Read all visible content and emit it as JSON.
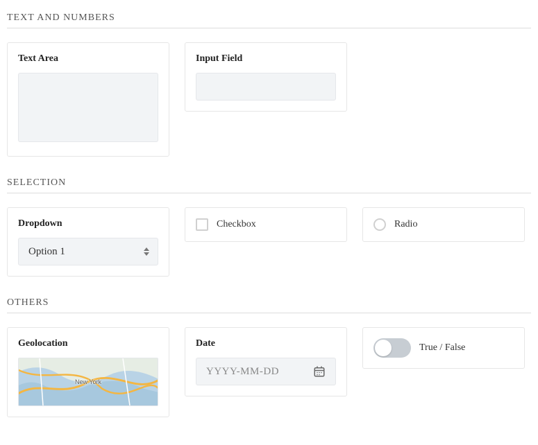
{
  "sections": {
    "text_numbers": {
      "title": "TEXT AND NUMBERS",
      "text_area": {
        "label": "Text Area",
        "value": ""
      },
      "input_field": {
        "label": "Input Field",
        "value": ""
      }
    },
    "selection": {
      "title": "SELECTION",
      "dropdown": {
        "label": "Dropdown",
        "selected": "Option 1"
      },
      "checkbox": {
        "label": "Checkbox",
        "checked": false
      },
      "radio": {
        "label": "Radio",
        "checked": false
      }
    },
    "others": {
      "title": "OTHERS",
      "geolocation": {
        "label": "Geolocation",
        "map_center_label": "New York"
      },
      "date": {
        "label": "Date",
        "placeholder": "YYYY-MM-DD",
        "value": ""
      },
      "toggle": {
        "label": "True / False",
        "on": false
      }
    }
  }
}
